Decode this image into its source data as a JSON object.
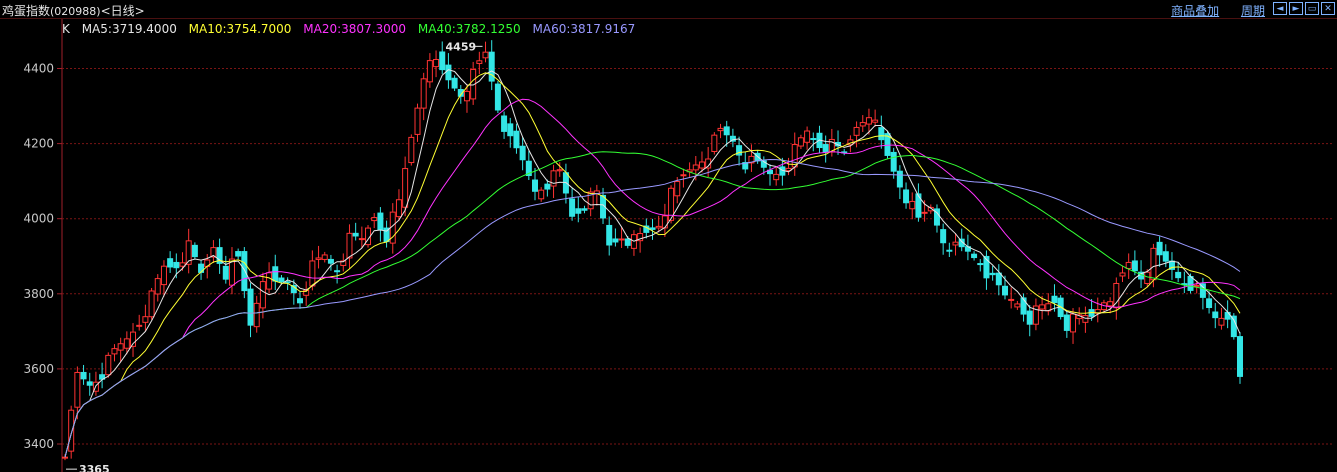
{
  "window": {
    "title": "鸡蛋指数",
    "code": "(020988)",
    "period": "<日线>"
  },
  "toolbar": {
    "overlay_link": "商品叠加",
    "period_link": "周期",
    "nav_buttons": [
      {
        "icon": "arrow-left-icon",
        "glyph": "◄"
      },
      {
        "icon": "arrow-right-icon",
        "glyph": "►"
      },
      {
        "icon": "restore-icon",
        "glyph": "▭"
      },
      {
        "icon": "close-icon",
        "glyph": "✕"
      }
    ]
  },
  "legend": {
    "k_label": "K",
    "items": [
      {
        "text": "MA5:3719.4000",
        "color": "#e6e6e6"
      },
      {
        "text": "MA10:3754.7000",
        "color": "#ffff33"
      },
      {
        "text": "MA20:3807.3000",
        "color": "#ff33ff"
      },
      {
        "text": "MA40:3782.1250",
        "color": "#33ff33"
      },
      {
        "text": "MA60:3817.9167",
        "color": "#9999ff"
      }
    ]
  },
  "chart_data": {
    "type": "candlestick",
    "ylim": [
      3360,
      4480
    ],
    "yticks": [
      3400,
      3600,
      3800,
      4000,
      4200,
      4400
    ],
    "ytick_labels": [
      "3400",
      "3600",
      "3800",
      "4000",
      "4200",
      "4400"
    ],
    "grid": true,
    "annotations": [
      {
        "text": "4459",
        "value": 4459
      },
      {
        "text": "3365",
        "value": 3365
      }
    ],
    "colors": {
      "up": "#ff3333",
      "down": "#33e6e6",
      "grid": "#7a1414",
      "axis": "#a0202a",
      "ma5": "#e6e6e6",
      "ma10": "#ffff33",
      "ma20": "#ff33ff",
      "ma40": "#33ff33",
      "ma60": "#9999ff"
    },
    "close_anchors": [
      [
        0,
        3365
      ],
      [
        2,
        3580
      ],
      [
        4,
        3560
      ],
      [
        6,
        3590
      ],
      [
        8,
        3640
      ],
      [
        10,
        3680
      ],
      [
        12,
        3730
      ],
      [
        14,
        3790
      ],
      [
        16,
        3870
      ],
      [
        18,
        3880
      ],
      [
        20,
        3920
      ],
      [
        22,
        3850
      ],
      [
        24,
        3930
      ],
      [
        26,
        3860
      ],
      [
        28,
        3890
      ],
      [
        30,
        3720
      ],
      [
        32,
        3850
      ],
      [
        34,
        3820
      ],
      [
        36,
        3830
      ],
      [
        38,
        3790
      ],
      [
        40,
        3870
      ],
      [
        42,
        3900
      ],
      [
        44,
        3870
      ],
      [
        46,
        3940
      ],
      [
        48,
        3940
      ],
      [
        50,
        4010
      ],
      [
        52,
        3960
      ],
      [
        54,
        4040
      ],
      [
        56,
        4220
      ],
      [
        58,
        4390
      ],
      [
        60,
        4410
      ],
      [
        62,
        4370
      ],
      [
        64,
        4340
      ],
      [
        66,
        4380
      ],
      [
        68,
        4440
      ],
      [
        70,
        4300
      ],
      [
        72,
        4200
      ],
      [
        74,
        4150
      ],
      [
        76,
        4080
      ],
      [
        78,
        4100
      ],
      [
        80,
        4120
      ],
      [
        82,
        4010
      ],
      [
        84,
        4040
      ],
      [
        86,
        4060
      ],
      [
        88,
        3930
      ],
      [
        90,
        3960
      ],
      [
        92,
        3940
      ],
      [
        94,
        3960
      ],
      [
        96,
        3990
      ],
      [
        98,
        4060
      ],
      [
        100,
        4110
      ],
      [
        102,
        4150
      ],
      [
        104,
        4180
      ],
      [
        106,
        4230
      ],
      [
        108,
        4210
      ],
      [
        110,
        4150
      ],
      [
        112,
        4140
      ],
      [
        114,
        4120
      ],
      [
        116,
        4130
      ],
      [
        118,
        4180
      ],
      [
        120,
        4230
      ],
      [
        122,
        4200
      ],
      [
        124,
        4190
      ],
      [
        126,
        4170
      ],
      [
        128,
        4250
      ],
      [
        130,
        4290
      ],
      [
        132,
        4200
      ],
      [
        134,
        4130
      ],
      [
        136,
        4060
      ],
      [
        138,
        3990
      ],
      [
        140,
        4030
      ],
      [
        142,
        3950
      ],
      [
        144,
        3920
      ],
      [
        146,
        3910
      ],
      [
        148,
        3890
      ],
      [
        150,
        3830
      ],
      [
        152,
        3790
      ],
      [
        154,
        3780
      ],
      [
        156,
        3740
      ],
      [
        158,
        3760
      ],
      [
        160,
        3780
      ],
      [
        162,
        3720
      ],
      [
        164,
        3730
      ],
      [
        166,
        3740
      ],
      [
        168,
        3790
      ],
      [
        170,
        3810
      ],
      [
        172,
        3880
      ],
      [
        174,
        3850
      ],
      [
        176,
        3900
      ],
      [
        178,
        3880
      ],
      [
        180,
        3850
      ],
      [
        182,
        3830
      ],
      [
        184,
        3780
      ],
      [
        186,
        3740
      ],
      [
        188,
        3750
      ],
      [
        190,
        3580
      ]
    ],
    "moving_averages": [
      {
        "name": "MA5",
        "value": 3719.4
      },
      {
        "name": "MA10",
        "value": 3754.7
      },
      {
        "name": "MA20",
        "value": 3807.3
      },
      {
        "name": "MA40",
        "value": 3782.125
      },
      {
        "name": "MA60",
        "value": 3817.9167
      }
    ]
  }
}
